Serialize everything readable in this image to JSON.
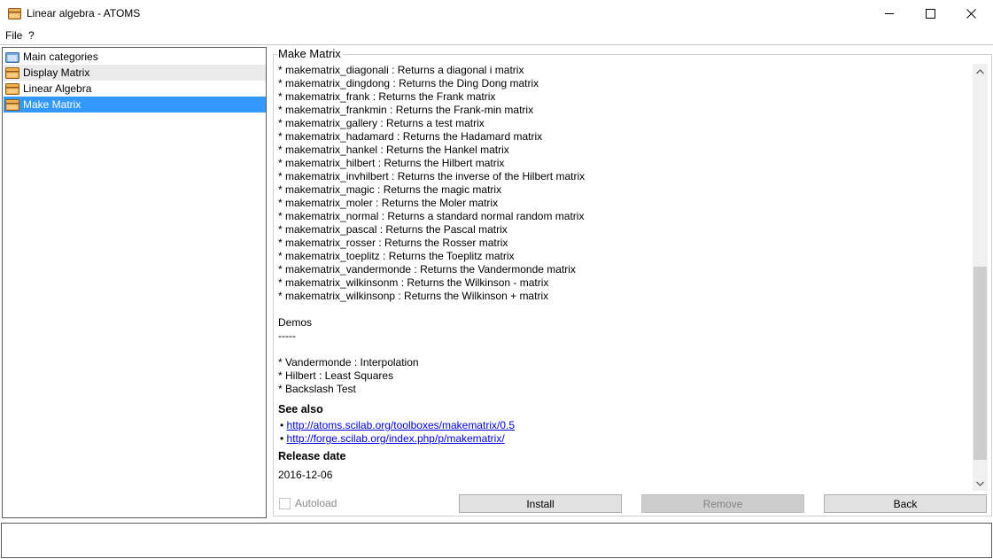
{
  "window": {
    "title": "Linear algebra - ATOMS"
  },
  "menu": {
    "file": "File",
    "help": "?"
  },
  "tree": {
    "items": [
      {
        "label": "Main categories",
        "icon": "folder-icon"
      },
      {
        "label": "Display Matrix",
        "icon": "package-icon"
      },
      {
        "label": "Linear Algebra",
        "icon": "package-icon"
      },
      {
        "label": "Make Matrix",
        "icon": "package-icon"
      }
    ]
  },
  "detail": {
    "title": "Make Matrix",
    "function_lines": [
      "* makematrix_diagonali : Returns a diagonal i matrix",
      "* makematrix_dingdong : Returns the Ding Dong matrix",
      "* makematrix_frank : Returns the Frank matrix",
      "* makematrix_frankmin : Returns the Frank-min matrix",
      "* makematrix_gallery : Returns a test matrix",
      "* makematrix_hadamard : Returns the Hadamard matrix",
      "* makematrix_hankel : Returns the Hankel matrix",
      "* makematrix_hilbert : Returns the Hilbert matrix",
      "* makematrix_invhilbert : Returns the inverse of the Hilbert matrix",
      "* makematrix_magic : Returns the magic matrix",
      "* makematrix_moler : Returns the Moler matrix",
      "* makematrix_normal : Returns a standard normal random matrix",
      "* makematrix_pascal : Returns the Pascal matrix",
      "* makematrix_rosser : Returns the Rosser matrix",
      "* makematrix_toeplitz : Returns the Toeplitz matrix",
      "* makematrix_vandermonde : Returns the Vandermonde matrix",
      "* makematrix_wilkinsonm : Returns the Wilkinson - matrix",
      "* makematrix_wilkinsonp : Returns the Wilkinson + matrix"
    ],
    "demos_heading": "Demos",
    "demos_underline": "-----",
    "demo_lines": [
      "* Vandermonde : Interpolation",
      "* Hilbert : Least Squares",
      "* Backslash Test"
    ],
    "see_also_heading": "See also",
    "links": [
      "http://atoms.scilab.org/toolboxes/makematrix/0.5",
      "http://forge.scilab.org/index.php/p/makematrix/"
    ],
    "release_heading": "Release date",
    "release_date": "2016-12-06"
  },
  "controls": {
    "autoload_label": "Autoload",
    "autoload_checked": false,
    "install_label": "Install",
    "remove_label": "Remove",
    "back_label": "Back"
  },
  "status": {
    "text": ""
  },
  "scroll": {
    "position_fraction": 0.53
  }
}
